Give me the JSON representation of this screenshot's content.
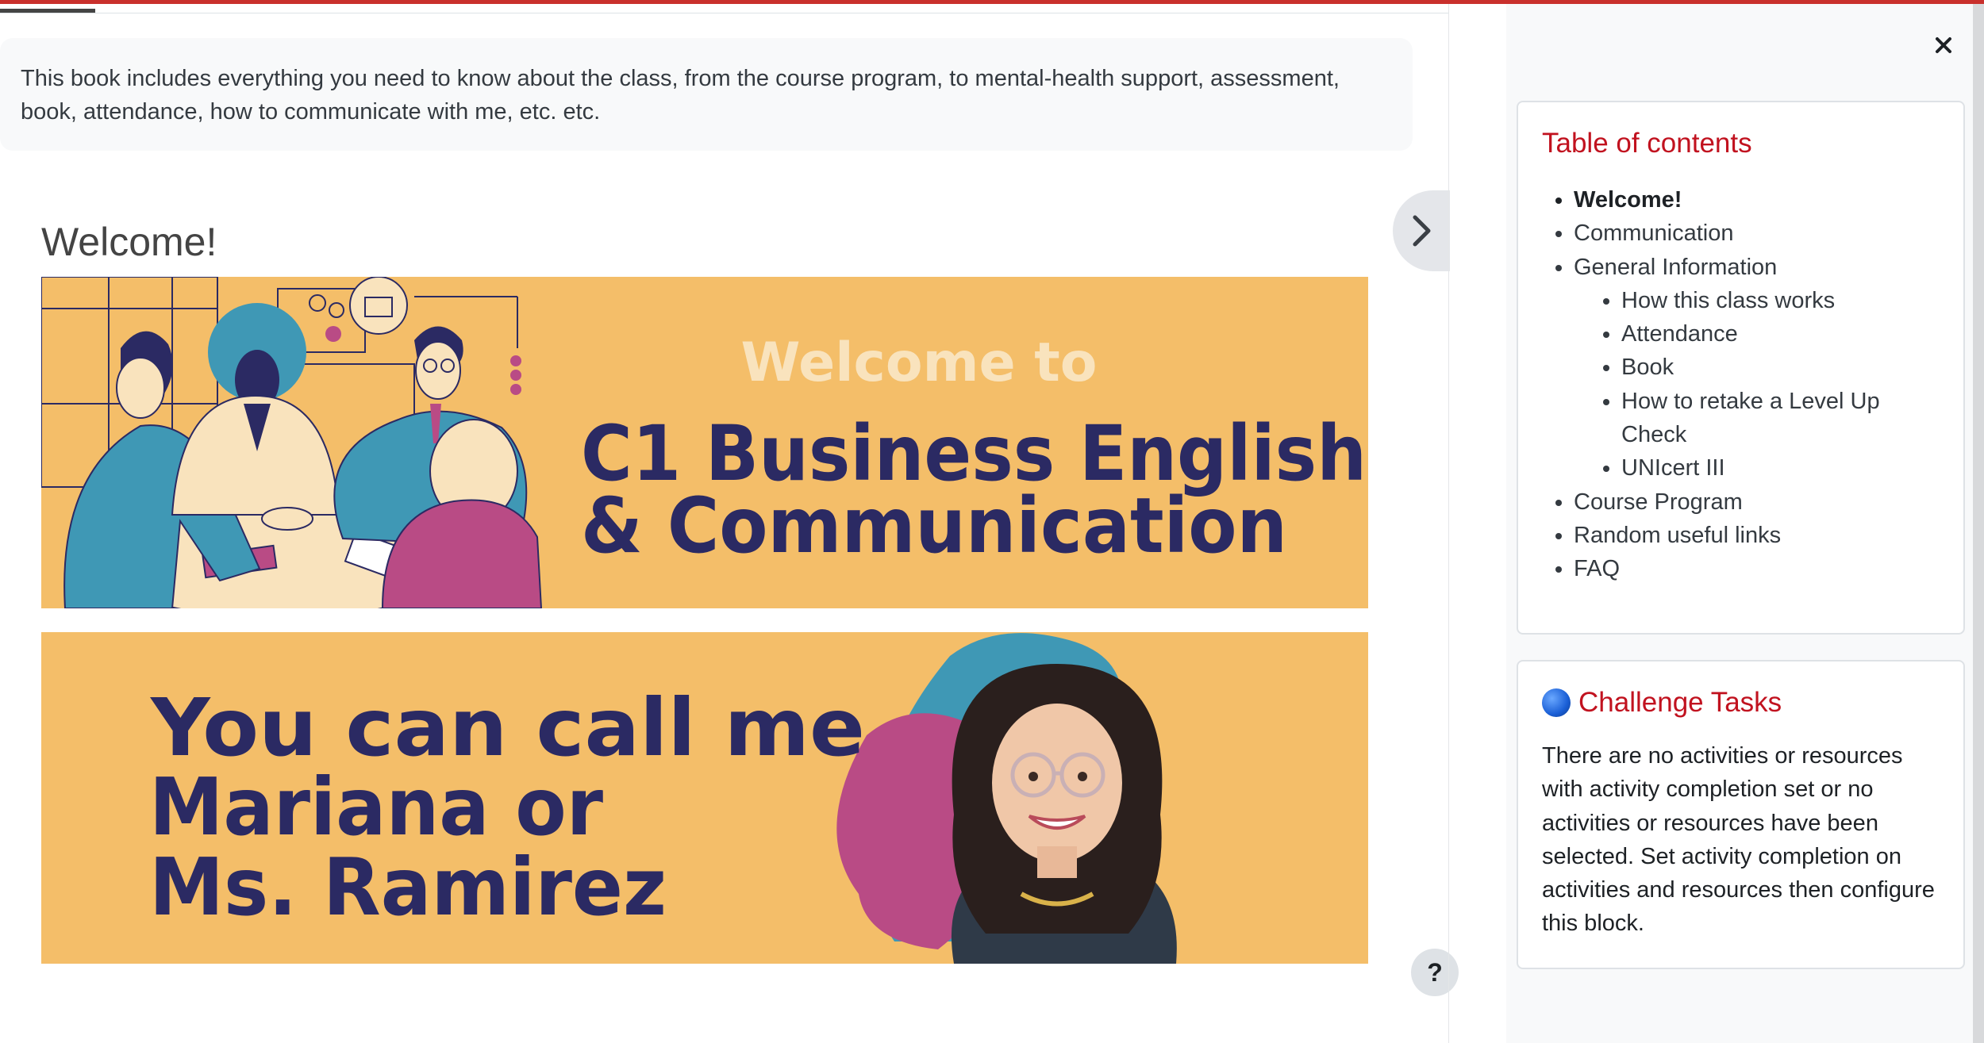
{
  "intro": {
    "text": "This book includes everything you need to know about the class, from the course program, to mental-health support, assessment, book, attendance, how to communicate with me, etc. etc."
  },
  "chapter": {
    "title": "Welcome!"
  },
  "banner1": {
    "line1": "Welcome to",
    "line2": "C1 Business English",
    "line3": "& Communication"
  },
  "banner2": {
    "line1": "You can call me",
    "line2": "Mariana or",
    "line3": "Ms. Ramirez"
  },
  "help": {
    "label": "?"
  },
  "drawer": {
    "toc": {
      "title": "Table of contents",
      "items": [
        {
          "label": "Welcome!"
        },
        {
          "label": "Communication"
        },
        {
          "label": "General Information"
        },
        {
          "label": "How this class works"
        },
        {
          "label": "Attendance"
        },
        {
          "label": "Book"
        },
        {
          "label": "How to retake a Level Up Check"
        },
        {
          "label": "UNIcert III"
        },
        {
          "label": "Course Program"
        },
        {
          "label": "Random useful links"
        },
        {
          "label": "FAQ"
        }
      ]
    },
    "challenge": {
      "title": "Challenge Tasks",
      "text": "There are no activities or resources with activity completion set or no activities or resources have been selected. Set activity completion on activities and resources then configure this block."
    }
  },
  "colors": {
    "accent": "#c1121f",
    "banner_bg": "#f4be69",
    "banner_text": "#2b2a63",
    "teal": "#3f98b5",
    "magenta": "#b94b85",
    "cream": "#f9e3bd"
  }
}
